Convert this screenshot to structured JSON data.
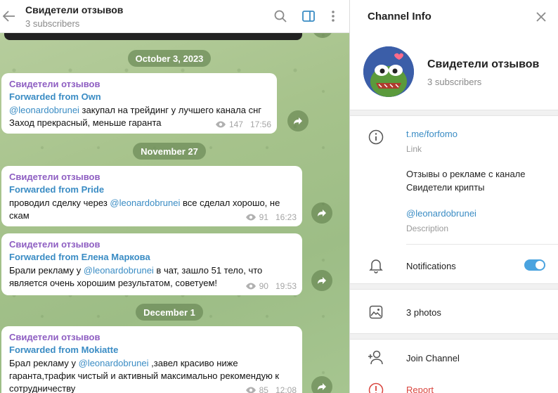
{
  "header": {
    "title": "Свидетели отзывов",
    "subtitle": "3 subscribers"
  },
  "dates": [
    "October 3, 2023",
    "November 27",
    "December 1"
  ],
  "messages": [
    {
      "channel": "Свидетели отзывов",
      "forwarded": "Forwarded from Own",
      "mention": "@leonardobrunei",
      "text_after_mention": " закупал на трейдинг у лучшего канала снг",
      "text_line2": "Заход прекрасный, меньше гаранта",
      "views": "147",
      "time": "17:56"
    },
    {
      "channel": "Свидетели отзывов",
      "forwarded": "Forwarded from Pride",
      "text_before_mention": "проводил сделку через ",
      "mention": "@leonardobrunei",
      "text_after_mention": " все сделал хорошо, не",
      "text_line2": "скам",
      "views": "91",
      "time": "16:23"
    },
    {
      "channel": "Свидетели отзывов",
      "forwarded": "Forwarded from Елена Маркова",
      "text_before_mention": "Брали рекламу у ",
      "mention": "@leonardobrunei",
      "text_after_mention": " в чат, зашло 51 тело, что",
      "text_line2": "является очень хорошим результатом, советуем!",
      "views": "90",
      "time": "19:53"
    },
    {
      "channel": "Свидетели отзывов",
      "forwarded": "Forwarded from Mokiatte",
      "text_before_mention": "Брал рекламу у ",
      "mention": "@leonardobrunei",
      "text_after_mention": " ,завел красиво ниже",
      "text_line2": "гаранта,трафик чистый и активный максимально рекомендую к",
      "text_line3": "сотрудничеству",
      "views": "85",
      "time": "12:08"
    }
  ],
  "panel": {
    "title": "Channel Info",
    "name": "Свидетели отзывов",
    "subscribers": "3 subscribers",
    "link": "t.me/forfomo",
    "link_label": "Link",
    "description_line1": "Отзывы о рекламе с канале",
    "description_line2": "Свидетели крипты",
    "description_mention": "@leonardobrunei",
    "description_label": "Description",
    "notifications": "Notifications",
    "photos": "3 photos",
    "join": "Join Channel",
    "report": "Report"
  },
  "colors": {
    "accent": "#3a8cc4",
    "channel_name": "#8e5ec2",
    "toggle_on": "#4aa3df",
    "report": "#d9453e"
  },
  "icons": [
    "back-arrow-icon",
    "search-icon",
    "sidebar-toggle-icon",
    "more-vertical-icon",
    "forward-icon",
    "eye-icon",
    "close-icon",
    "info-icon",
    "bell-icon",
    "photo-icon",
    "add-user-icon",
    "report-icon"
  ]
}
